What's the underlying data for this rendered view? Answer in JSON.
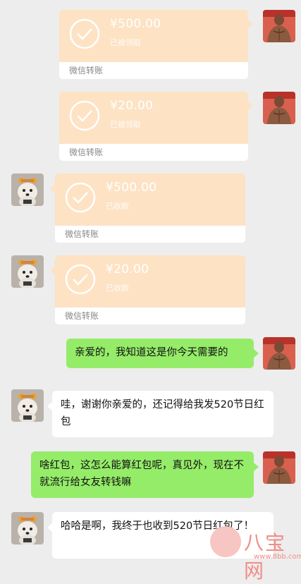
{
  "messages": [
    {
      "type": "transfer",
      "side": "right",
      "amount": "¥500.00",
      "status": "已被领取",
      "footer": "微信转账"
    },
    {
      "type": "transfer",
      "side": "right",
      "amount": "¥20.00",
      "status": "已被领取",
      "footer": "微信转账"
    },
    {
      "type": "transfer",
      "side": "left",
      "amount": "¥500.00",
      "status": "已收款",
      "footer": "微信转账"
    },
    {
      "type": "transfer",
      "side": "left",
      "amount": "¥20.00",
      "status": "已收款",
      "footer": "微信转账"
    },
    {
      "type": "text",
      "side": "right",
      "text": "亲爱的，我知道这是你今天需要的"
    },
    {
      "type": "text",
      "side": "left",
      "text": "哇，谢谢你亲爱的，还记得给我发520节日红包"
    },
    {
      "type": "text",
      "side": "right",
      "text": "啥红包，这怎么能算红包呢，真见外，现在不就流行给女友转钱嘛"
    },
    {
      "type": "text",
      "side": "left",
      "text": "哈哈是啊，我终于也收到520节日红包了！"
    }
  ],
  "watermark": {
    "name": "八宝网",
    "url": "www.8bb.com"
  },
  "colors": {
    "background": "#ededed",
    "transfer": "#fde2c4",
    "green_bubble": "#95ec69",
    "white_bubble": "#ffffff"
  },
  "icons": {
    "transfer_icon": "check-circle-icon",
    "right_avatar": "muscular-man-avatar",
    "left_avatar": "dog-avatar"
  }
}
